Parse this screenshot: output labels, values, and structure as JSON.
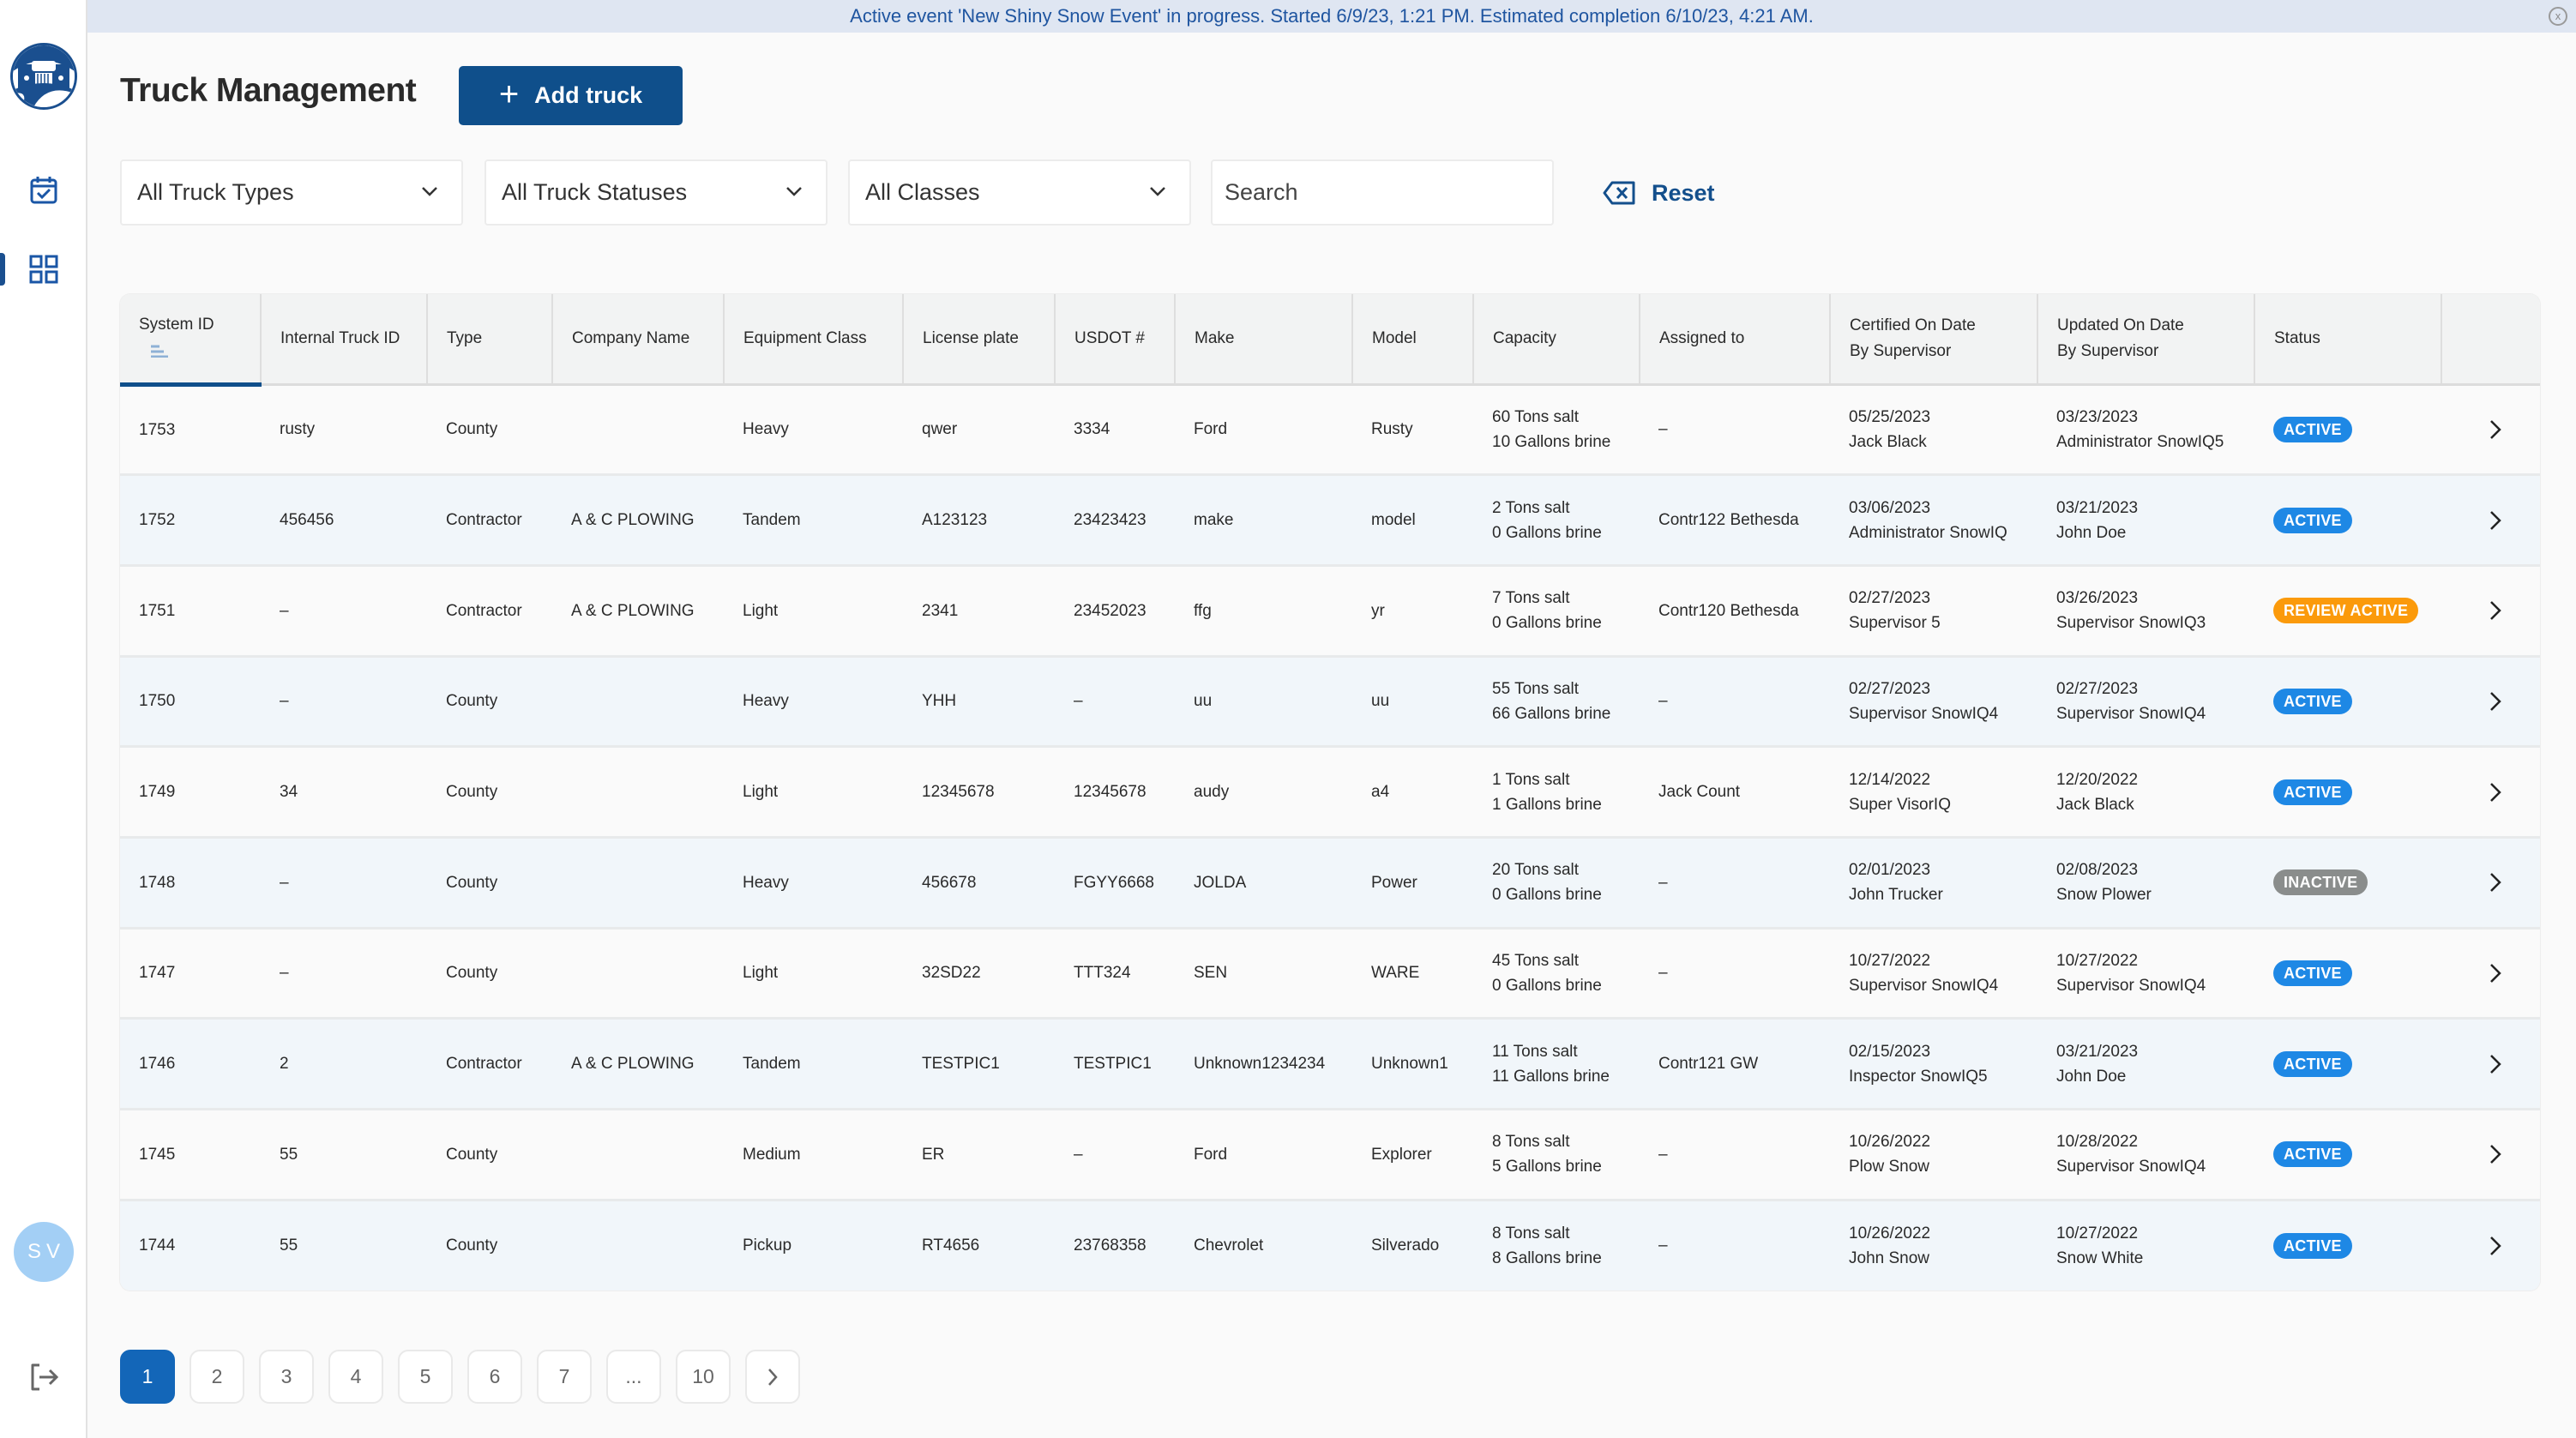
{
  "banner": {
    "message": "Active event 'New Shiny Snow Event' in progress. Started 6/9/23, 1:21 PM. Estimated completion 6/10/23, 4:21 AM.",
    "close_glyph": "x"
  },
  "sidebar": {
    "items": [
      {
        "name": "schedule",
        "icon": "calendar-check-icon"
      },
      {
        "name": "dashboard",
        "icon": "grid-icon",
        "active": true
      }
    ],
    "user_initials": "SV",
    "logout_icon": "logout-icon"
  },
  "header": {
    "title": "Truck Management",
    "add_button_label": "Add truck",
    "add_button_icon": "+"
  },
  "filters": {
    "truck_type": "All Truck Types",
    "truck_status": "All Truck Statuses",
    "classes": "All Classes",
    "search_placeholder": "Search",
    "search_value": "",
    "reset_label": "Reset"
  },
  "table": {
    "columns": [
      "System ID",
      "Internal Truck ID",
      "Type",
      "Company Name",
      "Equipment Class",
      "License plate",
      "USDOT #",
      "Make",
      "Model",
      "Capacity",
      "Assigned to",
      "Certified On Date",
      "By Supervisor",
      "Updated On Date",
      "By Supervisor",
      "Status"
    ],
    "header": {
      "system_id": "System ID",
      "internal_id": "Internal Truck ID",
      "type": "Type",
      "company": "Company Name",
      "equip_class": "Equipment Class",
      "plate": "License plate",
      "usdot": "USDOT #",
      "make": "Make",
      "model": "Model",
      "capacity": "Capacity",
      "assigned": "Assigned to",
      "certified_1": "Certified On Date",
      "certified_2": "By Supervisor",
      "updated_1": "Updated On Date",
      "updated_2": "By Supervisor",
      "status": "Status"
    },
    "status_colors": {
      "ACTIVE": "#1e88e5",
      "REVIEW ACTIVE": "#fb9a0b",
      "INACTIVE": "#8a8d8c"
    },
    "rows": [
      {
        "system_id": "1753",
        "internal_id": "rusty",
        "type": "County",
        "company": "",
        "equip_class": "Heavy",
        "plate": "qwer",
        "usdot": "3334",
        "make": "Ford",
        "model": "Rusty",
        "salt": "60 Tons salt",
        "brine": "10 Gallons brine",
        "assigned": "–",
        "cert_date": "05/25/2023",
        "cert_by": "Jack Black",
        "upd_date": "03/23/2023",
        "upd_by": "Administrator SnowIQ5",
        "status": "ACTIVE"
      },
      {
        "system_id": "1752",
        "internal_id": "456456",
        "type": "Contractor",
        "company": "A & C PLOWING",
        "equip_class": "Tandem",
        "plate": "A123123",
        "usdot": "23423423",
        "make": "make",
        "model": "model",
        "salt": "2 Tons salt",
        "brine": "0 Gallons brine",
        "assigned": "Contr122 Bethesda",
        "cert_date": "03/06/2023",
        "cert_by": "Administrator SnowIQ",
        "upd_date": "03/21/2023",
        "upd_by": "John Doe",
        "status": "ACTIVE"
      },
      {
        "system_id": "1751",
        "internal_id": "–",
        "type": "Contractor",
        "company": "A & C PLOWING",
        "equip_class": "Light",
        "plate": "2341",
        "usdot": "23452023",
        "make": "ffg",
        "model": "yr",
        "salt": "7 Tons salt",
        "brine": "0 Gallons brine",
        "assigned": "Contr120 Bethesda",
        "cert_date": "02/27/2023",
        "cert_by": "Supervisor 5",
        "upd_date": "03/26/2023",
        "upd_by": "Supervisor SnowIQ3",
        "status": "REVIEW ACTIVE"
      },
      {
        "system_id": "1750",
        "internal_id": "–",
        "type": "County",
        "company": "",
        "equip_class": "Heavy",
        "plate": "YHH",
        "usdot": "–",
        "make": "uu",
        "model": "uu",
        "salt": "55 Tons salt",
        "brine": "66 Gallons brine",
        "assigned": "–",
        "cert_date": "02/27/2023",
        "cert_by": "Supervisor SnowIQ4",
        "upd_date": "02/27/2023",
        "upd_by": "Supervisor SnowIQ4",
        "status": "ACTIVE"
      },
      {
        "system_id": "1749",
        "internal_id": "34",
        "type": "County",
        "company": "",
        "equip_class": "Light",
        "plate": "12345678",
        "usdot": "12345678",
        "make": "audy",
        "model": "a4",
        "salt": "1 Tons salt",
        "brine": "1 Gallons brine",
        "assigned": "Jack Count",
        "cert_date": "12/14/2022",
        "cert_by": "Super VisorIQ",
        "upd_date": "12/20/2022",
        "upd_by": "Jack Black",
        "status": "ACTIVE"
      },
      {
        "system_id": "1748",
        "internal_id": "–",
        "type": "County",
        "company": "",
        "equip_class": "Heavy",
        "plate": "456678",
        "usdot": "FGYY6668",
        "make": "JOLDA",
        "model": "Power",
        "salt": "20 Tons salt",
        "brine": "0 Gallons brine",
        "assigned": "–",
        "cert_date": "02/01/2023",
        "cert_by": "John Trucker",
        "upd_date": "02/08/2023",
        "upd_by": "Snow Plower",
        "status": "INACTIVE"
      },
      {
        "system_id": "1747",
        "internal_id": "–",
        "type": "County",
        "company": "",
        "equip_class": "Light",
        "plate": "32SD22",
        "usdot": "TTT324",
        "make": "SEN",
        "model": "WARE",
        "salt": "45 Tons salt",
        "brine": "0 Gallons brine",
        "assigned": "–",
        "cert_date": "10/27/2022",
        "cert_by": "Supervisor SnowIQ4",
        "upd_date": "10/27/2022",
        "upd_by": "Supervisor SnowIQ4",
        "status": "ACTIVE"
      },
      {
        "system_id": "1746",
        "internal_id": "2",
        "type": "Contractor",
        "company": "A & C PLOWING",
        "equip_class": "Tandem",
        "plate": "TESTPIC1",
        "usdot": "TESTPIC1",
        "make": "Unknown1234234",
        "model": "Unknown1",
        "salt": "11 Tons salt",
        "brine": "11 Gallons brine",
        "assigned": "Contr121 GW",
        "cert_date": "02/15/2023",
        "cert_by": "Inspector SnowIQ5",
        "upd_date": "03/21/2023",
        "upd_by": "John Doe",
        "status": "ACTIVE"
      },
      {
        "system_id": "1745",
        "internal_id": "55",
        "type": "County",
        "company": "",
        "equip_class": "Medium",
        "plate": "ER",
        "usdot": "–",
        "make": "Ford",
        "model": "Explorer",
        "salt": "8 Tons salt",
        "brine": "5 Gallons brine",
        "assigned": "–",
        "cert_date": "10/26/2022",
        "cert_by": "Plow Snow",
        "upd_date": "10/28/2022",
        "upd_by": "Supervisor SnowIQ4",
        "status": "ACTIVE"
      },
      {
        "system_id": "1744",
        "internal_id": "55",
        "type": "County",
        "company": "",
        "equip_class": "Pickup",
        "plate": "RT4656",
        "usdot": "23768358",
        "make": "Chevrolet",
        "model": "Silverado",
        "salt": "8 Tons salt",
        "brine": "8 Gallons brine",
        "assigned": "–",
        "cert_date": "10/26/2022",
        "cert_by": "John Snow",
        "upd_date": "10/27/2022",
        "upd_by": "Snow White",
        "status": "ACTIVE"
      }
    ]
  },
  "pagination": {
    "current": "1",
    "pages": [
      "1",
      "2",
      "3",
      "4",
      "5",
      "6",
      "7",
      "...",
      "10"
    ],
    "next_icon": "chevron-right-icon"
  },
  "colors": {
    "primary": "#0f4f8b",
    "banner_bg": "#dfe6f2",
    "banner_text": "#1f55a0",
    "page_active": "#1366b8"
  }
}
